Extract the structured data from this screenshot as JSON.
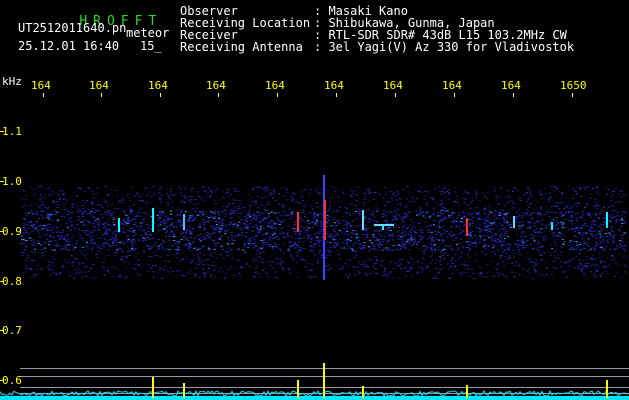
{
  "window": {
    "title_letters": "HROFFT",
    "filename": "UT2512011640.pn",
    "mode": "meteor",
    "datetime": "25.12.01 16:40",
    "interval": "15_"
  },
  "info": {
    "labels": [
      "Observer",
      "Receiving Location",
      "Receiver",
      "Receiving Antenna"
    ],
    "values": [
      ": Masaki Kano",
      ": Shibukawa, Gunma, Japan",
      ": RTL-SDR SDR# 43dB L15 103.2MHz CW",
      ": 3el Yagi(V) Az 330 for Vladivostok"
    ]
  },
  "axes": {
    "unit": "kHz",
    "x_ticks": [
      "164",
      "164",
      "164",
      "164",
      "164",
      "164",
      "164",
      "164",
      "164",
      "1650"
    ],
    "y_ticks": [
      "1.1",
      "1.0",
      "0.9",
      "0.8",
      "0.7",
      "0.6"
    ]
  },
  "colors": {
    "background": "#000000",
    "text": "#ffffff",
    "title": "#22dd22",
    "tick_label": "#ffff00",
    "axis_label": "#ffff00",
    "waterfall_base": "#1a1a8c",
    "signal_hot": "#ff3030",
    "signal_mid": "#00ffff",
    "spectrum_line": "#00e5ff",
    "spectrum_peak": "#ffff00",
    "scale_line": "#9999aa"
  }
}
